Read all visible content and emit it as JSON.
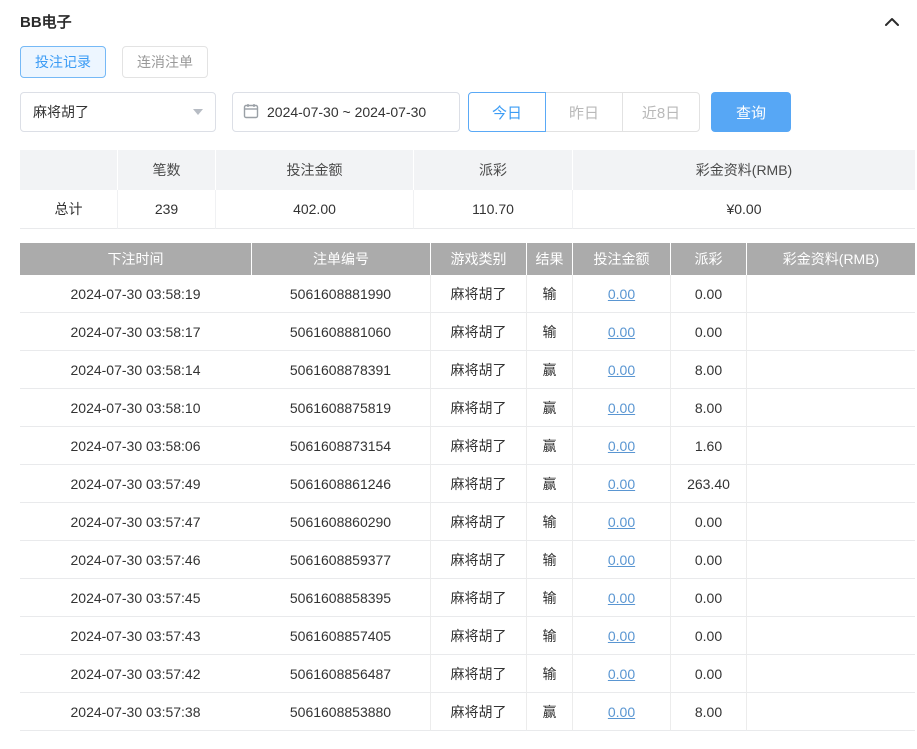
{
  "header": {
    "title": "BB电子",
    "collapse_icon": "chevron-up"
  },
  "tabs": [
    {
      "label": "投注记录",
      "active": true
    },
    {
      "label": "连消注单",
      "active": false
    }
  ],
  "filters": {
    "game_select_value": "麻将胡了",
    "date_range_value": "2024-07-30 ~ 2024-07-30",
    "quick_buttons": [
      {
        "label": "今日",
        "active": true
      },
      {
        "label": "昨日",
        "active": false
      },
      {
        "label": "近8日",
        "active": false
      }
    ],
    "search_label": "查询"
  },
  "summary": {
    "headers": [
      "",
      "笔数",
      "投注金额",
      "派彩",
      "彩金资料(RMB)"
    ],
    "row": [
      "总计",
      "239",
      "402.00",
      "110.70",
      "¥0.00"
    ]
  },
  "table": {
    "headers": [
      "下注时间",
      "注单编号",
      "游戏类别",
      "结果",
      "投注金额",
      "派彩",
      "彩金资料(RMB)"
    ],
    "rows": [
      [
        "2024-07-30 03:58:19",
        "5061608881990",
        "麻将胡了",
        "输",
        "0.00",
        "0.00",
        ""
      ],
      [
        "2024-07-30 03:58:17",
        "5061608881060",
        "麻将胡了",
        "输",
        "0.00",
        "0.00",
        ""
      ],
      [
        "2024-07-30 03:58:14",
        "5061608878391",
        "麻将胡了",
        "赢",
        "0.00",
        "8.00",
        ""
      ],
      [
        "2024-07-30 03:58:10",
        "5061608875819",
        "麻将胡了",
        "赢",
        "0.00",
        "8.00",
        ""
      ],
      [
        "2024-07-30 03:58:06",
        "5061608873154",
        "麻将胡了",
        "赢",
        "0.00",
        "1.60",
        ""
      ],
      [
        "2024-07-30 03:57:49",
        "5061608861246",
        "麻将胡了",
        "赢",
        "0.00",
        "263.40",
        ""
      ],
      [
        "2024-07-30 03:57:47",
        "5061608860290",
        "麻将胡了",
        "输",
        "0.00",
        "0.00",
        ""
      ],
      [
        "2024-07-30 03:57:46",
        "5061608859377",
        "麻将胡了",
        "输",
        "0.00",
        "0.00",
        ""
      ],
      [
        "2024-07-30 03:57:45",
        "5061608858395",
        "麻将胡了",
        "输",
        "0.00",
        "0.00",
        ""
      ],
      [
        "2024-07-30 03:57:43",
        "5061608857405",
        "麻将胡了",
        "输",
        "0.00",
        "0.00",
        ""
      ],
      [
        "2024-07-30 03:57:42",
        "5061608856487",
        "麻将胡了",
        "输",
        "0.00",
        "0.00",
        ""
      ],
      [
        "2024-07-30 03:57:38",
        "5061608853880",
        "麻将胡了",
        "赢",
        "0.00",
        "8.00",
        ""
      ]
    ]
  }
}
